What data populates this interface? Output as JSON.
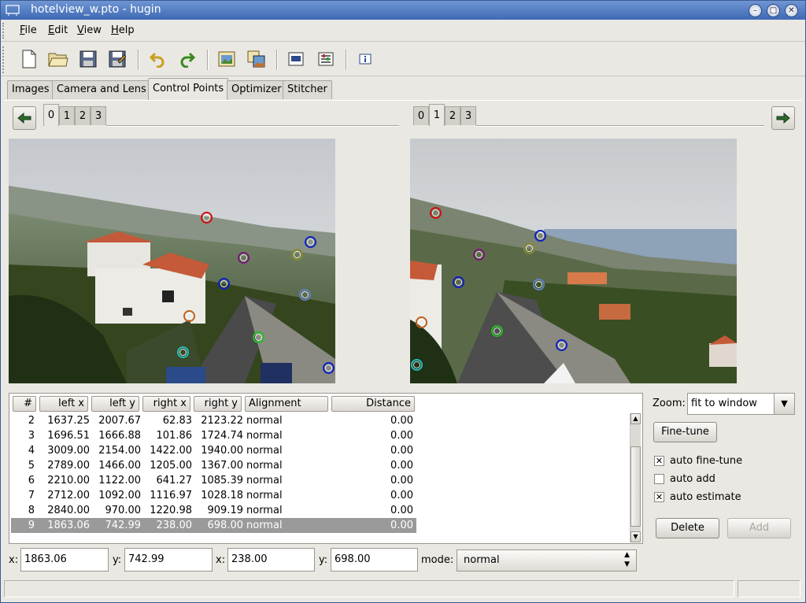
{
  "window": {
    "title": "hotelview_w.pto - hugin"
  },
  "menu": [
    {
      "label_pre": "",
      "label_key": "F",
      "label_post": "ile"
    },
    {
      "label_pre": "",
      "label_key": "E",
      "label_post": "dit"
    },
    {
      "label_pre": "",
      "label_key": "V",
      "label_post": "iew"
    },
    {
      "label_pre": "",
      "label_key": "H",
      "label_post": "elp"
    }
  ],
  "toolbar_icons": [
    "new-file-icon",
    "open-folder-icon",
    "save-icon",
    "save-as-icon",
    "undo-icon",
    "redo-icon",
    "add-image-icon",
    "add-series-icon",
    "preview-icon",
    "optimize-icon",
    "info-icon"
  ],
  "tabs": [
    "Images",
    "Camera and Lens",
    "Control Points",
    "Optimizer",
    "Stitcher"
  ],
  "active_tab": "Control Points",
  "left_image_tabs": [
    "0",
    "1",
    "2",
    "3"
  ],
  "left_active": "0",
  "right_image_tabs": [
    "0",
    "1",
    "2",
    "3"
  ],
  "right_active": "1",
  "table": {
    "headers": [
      "#",
      "left x",
      "left y",
      "right x",
      "right y",
      "Alignment",
      "Distance"
    ],
    "rows": [
      {
        "num": "2",
        "lx": "1637.25",
        "ly": "2007.67",
        "rx": "62.83",
        "ry": "2123.22",
        "align": "normal",
        "dist": "0.00"
      },
      {
        "num": "3",
        "lx": "1696.51",
        "ly": "1666.88",
        "rx": "101.86",
        "ry": "1724.74",
        "align": "normal",
        "dist": "0.00"
      },
      {
        "num": "4",
        "lx": "3009.00",
        "ly": "2154.00",
        "rx": "1422.00",
        "ry": "1940.00",
        "align": "normal",
        "dist": "0.00"
      },
      {
        "num": "5",
        "lx": "2789.00",
        "ly": "1466.00",
        "rx": "1205.00",
        "ry": "1367.00",
        "align": "normal",
        "dist": "0.00"
      },
      {
        "num": "6",
        "lx": "2210.00",
        "ly": "1122.00",
        "rx": "641.27",
        "ry": "1085.39",
        "align": "normal",
        "dist": "0.00"
      },
      {
        "num": "7",
        "lx": "2712.00",
        "ly": "1092.00",
        "rx": "1116.97",
        "ry": "1028.18",
        "align": "normal",
        "dist": "0.00"
      },
      {
        "num": "8",
        "lx": "2840.00",
        "ly": "970.00",
        "rx": "1220.98",
        "ry": "909.19",
        "align": "normal",
        "dist": "0.00"
      },
      {
        "num": "9",
        "lx": "1863.06",
        "ly": "742.99",
        "rx": "238.00",
        "ry": "698.00",
        "align": "normal",
        "dist": "0.00"
      }
    ],
    "selected_row": "9"
  },
  "zoom": {
    "label": "Zoom:",
    "value": "fit to window"
  },
  "fine_tune_label": "Fine-tune",
  "checks": [
    {
      "label": "auto fine-tune",
      "checked": true
    },
    {
      "label": "auto add",
      "checked": false
    },
    {
      "label": "auto estimate",
      "checked": true
    }
  ],
  "delete_label": "Delete",
  "add_label": "Add",
  "bottom": {
    "x_label": "x:",
    "left_x": "1863.06",
    "y_label": "y:",
    "left_y": "742.99",
    "x2_label": "x:",
    "right_x": "238.00",
    "y2_label": "y:",
    "right_y": "698.00",
    "mode_label": "mode:",
    "mode_value": "normal"
  },
  "colors": {
    "red": "#d01010",
    "blue": "#1020c0",
    "purple": "#7a1a7a",
    "olive": "#8a8a30",
    "lightblue": "#6080c0",
    "orange": "#c06020",
    "green": "#20c020",
    "cyan": "#20c0c0"
  }
}
